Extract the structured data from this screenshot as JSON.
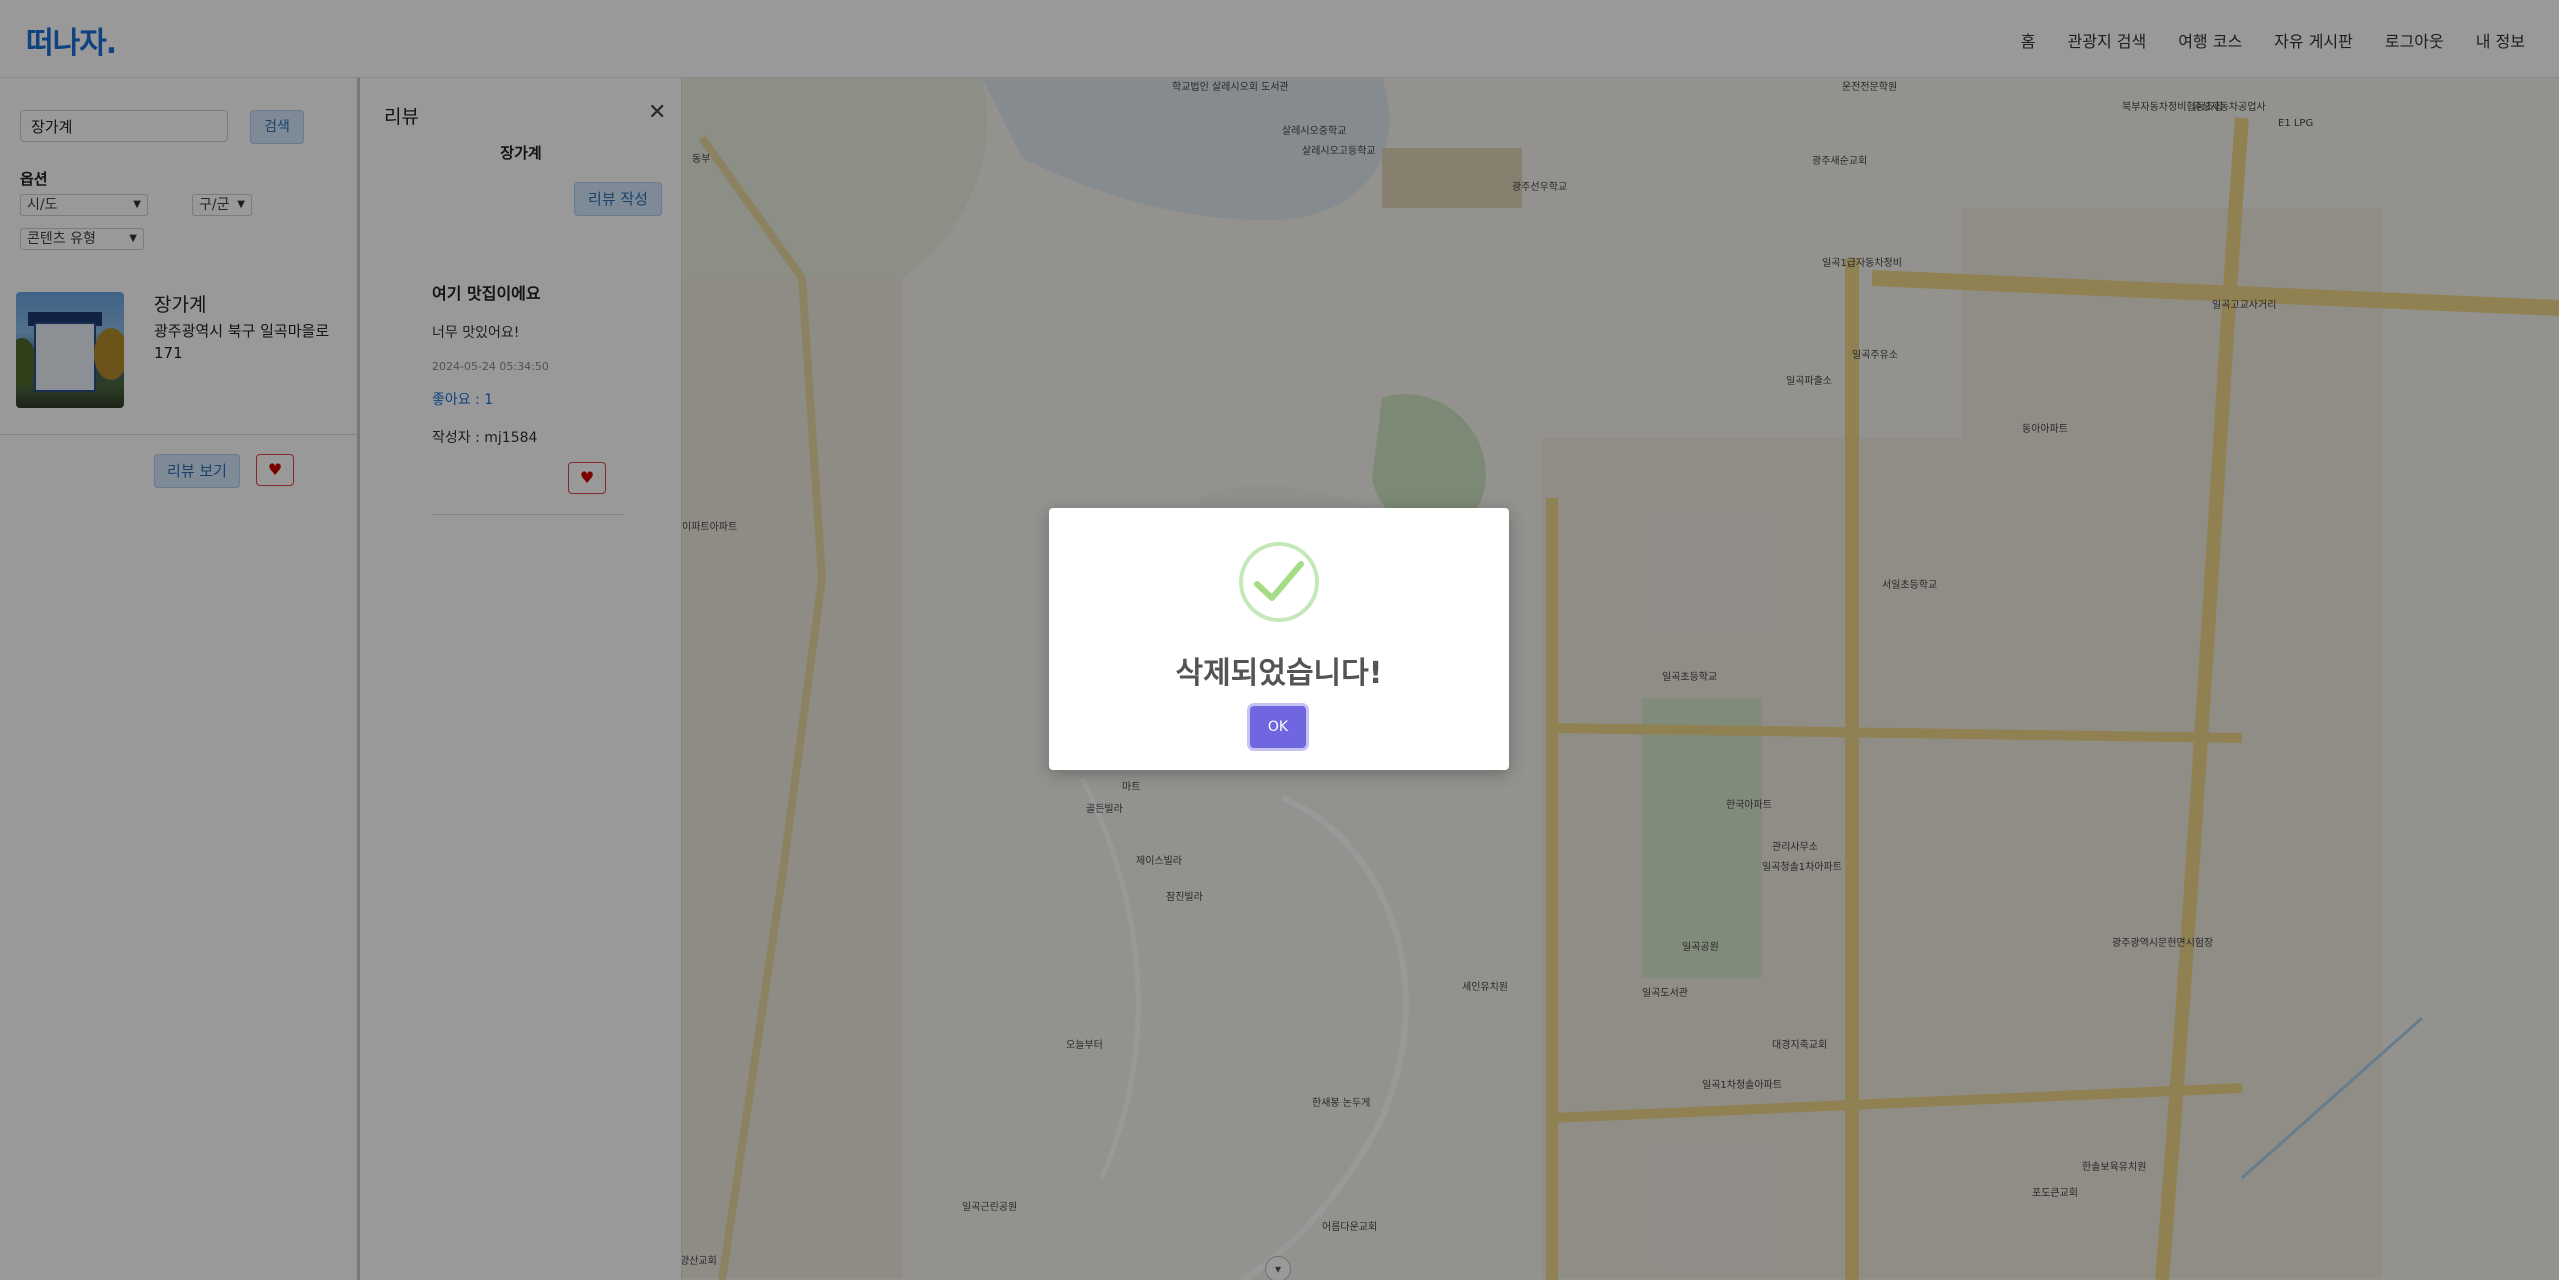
{
  "header": {
    "logo": "떠나자.",
    "nav": [
      "홈",
      "관광지 검색",
      "여행 코스",
      "자유 게시판",
      "로그아웃",
      "내 정보"
    ]
  },
  "sidebar": {
    "search_value": "장가계",
    "search_button": "검색",
    "options_label": "옵션",
    "select_sido": "시/도",
    "select_gugun": "구/군",
    "select_type": "콘텐츠 유형",
    "result": {
      "name": "장가계",
      "address": "광주광역시 북구 일곡마을로 171",
      "review_button": "리뷰 보기",
      "heart": "♥"
    }
  },
  "review_panel": {
    "title": "리뷰",
    "close": "✕",
    "place_name": "장가계",
    "write_button": "리뷰 작성",
    "review": {
      "title": "여기 맛집이에요",
      "body": "너무 맛있어요!",
      "date": "2024-05-24 05:34:50",
      "likes": "좋아요 : 1",
      "author": "작성자 : mj1584",
      "heart": "♥"
    }
  },
  "map": {
    "labels": [
      "학교법인 살레시오회 도서관",
      "살레시오중학교",
      "살레시오고등학교",
      "광주선우학교",
      "운전전문학원",
      "광주새순교회",
      "북부자동차정비협동조합",
      "유성자동차공업사",
      "E1 LPG",
      "일곡1급자동차정비",
      "일곡주유소",
      "일곡파출소",
      "일곡고교사거리",
      "관리사무소",
      "동아아파트",
      "일곡초등학교",
      "서일초등학교",
      "일곡도서관",
      "한국아파트",
      "일곡청솔1차아파트",
      "일곡공원",
      "광주광역시문현면시험장",
      "대경지축교회",
      "일곡1차청솔아파트",
      "세인유치원",
      "한솔보육유치원",
      "포도큰교회",
      "동부",
      "잠진빌라",
      "골든빌라",
      "마트",
      "오늘부터",
      "일곡근린공원",
      "양산교회",
      "이파트아파트",
      "제이스빌라",
      "한새봉 논두게",
      "어름다운교회"
    ]
  },
  "modal": {
    "title": "삭제되었습니다!",
    "ok": "OK"
  },
  "map_bottom_button": "▾"
}
